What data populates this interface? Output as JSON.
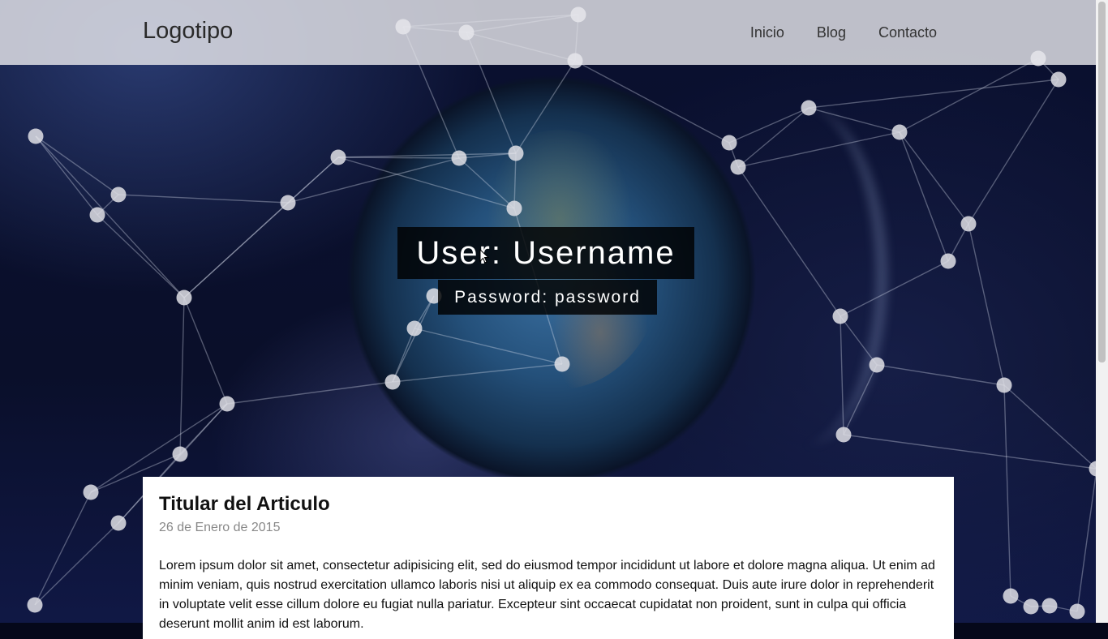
{
  "header": {
    "logo": "Logotipo",
    "nav": [
      "Inicio",
      "Blog",
      "Contacto"
    ]
  },
  "hero": {
    "title": "User: Username",
    "subtitle": "Password: password"
  },
  "article": {
    "title": "Titular del Articulo",
    "date": "26 de Enero de 2015",
    "body": "Lorem ipsum dolor sit amet, consectetur adipisicing elit, sed do eiusmod tempor incididunt ut labore et dolore magna aliqua. Ut enim ad minim veniam, quis nostrud exercitation ullamco laboris nisi ut aliquip ex ea commodo consequat. Duis aute irure dolor in reprehenderit in voluptate velit esse cillum dolore eu fugiat nulla pariatur. Excepteur sint occaecat cupidatat non proident, sunt in culpa qui officia deserunt mollit anim id est laborum."
  },
  "colors": {
    "header_bg": "#e6e6eb",
    "hero_box": "#000000",
    "network_node": "#d8d8dc"
  }
}
